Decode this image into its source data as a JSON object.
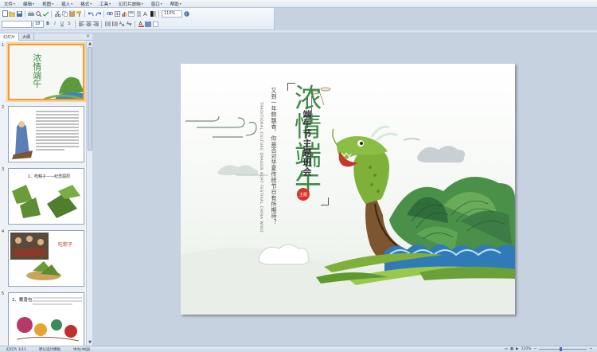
{
  "menu": {
    "items": [
      {
        "label": "文件",
        "icon": "file-icon"
      },
      {
        "label": "编辑",
        "icon": "edit-icon"
      },
      {
        "label": "视图",
        "icon": "view-icon"
      },
      {
        "label": "插入",
        "icon": "insert-icon"
      },
      {
        "label": "格式",
        "icon": "format-icon"
      },
      {
        "label": "工具",
        "icon": "tools-icon"
      },
      {
        "label": "幻灯片放映",
        "icon": "slideshow-icon"
      },
      {
        "label": "窗口",
        "icon": "window-icon"
      },
      {
        "label": "帮助",
        "icon": "help-icon"
      }
    ]
  },
  "toolbar": {
    "font_size": "18"
  },
  "side_panel": {
    "tab_slides": "幻灯片",
    "tab_outline": "大纲",
    "close": "×",
    "thumbnails": [
      {
        "num": "1"
      },
      {
        "num": "2"
      },
      {
        "num": "3",
        "caption": "1、吃粽子——纪念屈原"
      },
      {
        "num": "4",
        "caption": "吃粽子"
      },
      {
        "num": "5",
        "caption": "2、戴香包"
      }
    ]
  },
  "slide": {
    "title": "浓情端午",
    "subtitle": "端午节主题班会",
    "stamp": "主题",
    "vertical_text_1": "又到一年粽飘香，你是否对华夏传统节日有所期待？",
    "vertical_text_2": "TRADITIONAL CULTURE DRAGON BOAT FESTIVAL CHINA WIND"
  },
  "status": {
    "slide_info": "幻灯片 1/11",
    "design": "默认设计模板",
    "language": "中文(中国)",
    "zoom": "110%"
  },
  "colors": {
    "accent_green": "#3c8a4a",
    "dragon_green": "#7fb03a",
    "wave_blue": "#2f7bb8",
    "selection_orange": "#f39a3b",
    "stamp_red": "#d9342b"
  }
}
